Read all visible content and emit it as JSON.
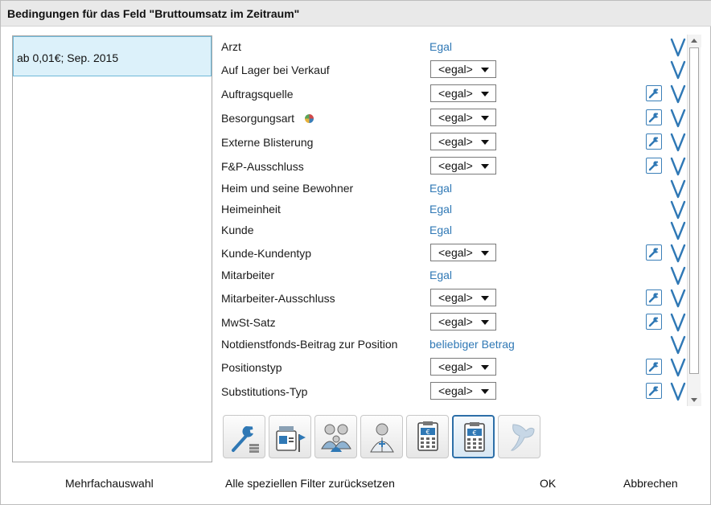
{
  "dialog": {
    "title": "Bedingungen für das Feld \"Bruttoumsatz im Zeitraum\""
  },
  "left_panel": {
    "items": [
      {
        "label": "ab 0,01€; Sep. 2015",
        "selected": true
      }
    ]
  },
  "conditions": [
    {
      "label": "Arzt",
      "kind": "link",
      "value": "Egal",
      "wrench": false
    },
    {
      "label": "Auf Lager bei Verkauf",
      "kind": "select",
      "value": "<egal>",
      "wrench": false
    },
    {
      "label": "Auftragsquelle",
      "kind": "select",
      "value": "<egal>",
      "wrench": true
    },
    {
      "label": "Besorgungsart",
      "kind": "select",
      "value": "<egal>",
      "wrench": true,
      "badge": "colored-pie-icon"
    },
    {
      "label": "Externe Blisterung",
      "kind": "select",
      "value": "<egal>",
      "wrench": true
    },
    {
      "label": "F&P-Ausschluss",
      "kind": "select",
      "value": "<egal>",
      "wrench": true
    },
    {
      "label": "Heim und seine Bewohner",
      "kind": "link",
      "value": "Egal",
      "wrench": false
    },
    {
      "label": "Heimeinheit",
      "kind": "link",
      "value": "Egal",
      "wrench": false
    },
    {
      "label": "Kunde",
      "kind": "link",
      "value": "Egal",
      "wrench": false
    },
    {
      "label": "Kunde-Kundentyp",
      "kind": "select",
      "value": "<egal>",
      "wrench": true
    },
    {
      "label": "Mitarbeiter",
      "kind": "link",
      "value": "Egal",
      "wrench": false
    },
    {
      "label": "Mitarbeiter-Ausschluss",
      "kind": "select",
      "value": "<egal>",
      "wrench": true
    },
    {
      "label": "MwSt-Satz",
      "kind": "select",
      "value": "<egal>",
      "wrench": true
    },
    {
      "label": "Notdienstfonds-Beitrag zur Position",
      "kind": "link",
      "value": "beliebiger Betrag",
      "wrench": false
    },
    {
      "label": "Positionstyp",
      "kind": "select",
      "value": "<egal>",
      "wrench": true
    },
    {
      "label": "Substitutions-Typ",
      "kind": "select",
      "value": "<egal>",
      "wrench": true
    }
  ],
  "toolbar": {
    "buttons": [
      {
        "icon": "wrench-stack-icon",
        "state": "normal"
      },
      {
        "icon": "medicine-flag-icon",
        "state": "normal"
      },
      {
        "icon": "family-group-icon",
        "state": "normal"
      },
      {
        "icon": "pharmacist-person-icon",
        "state": "normal"
      },
      {
        "icon": "euro-calculator-icon",
        "state": "normal"
      },
      {
        "icon": "euro-calculator-icon",
        "state": "active"
      },
      {
        "icon": "ginkgo-leaf-icon",
        "state": "disabled"
      }
    ]
  },
  "footer": {
    "multi_select": "Mehrfachauswahl",
    "reset_filters": "Alle speziellen Filter zurücksetzen",
    "ok": "OK",
    "cancel": "Abbrechen"
  },
  "colors": {
    "accent": "#2f78b5",
    "selection_bg": "#dcf1fa",
    "title_bar": "#e9e9e9"
  }
}
